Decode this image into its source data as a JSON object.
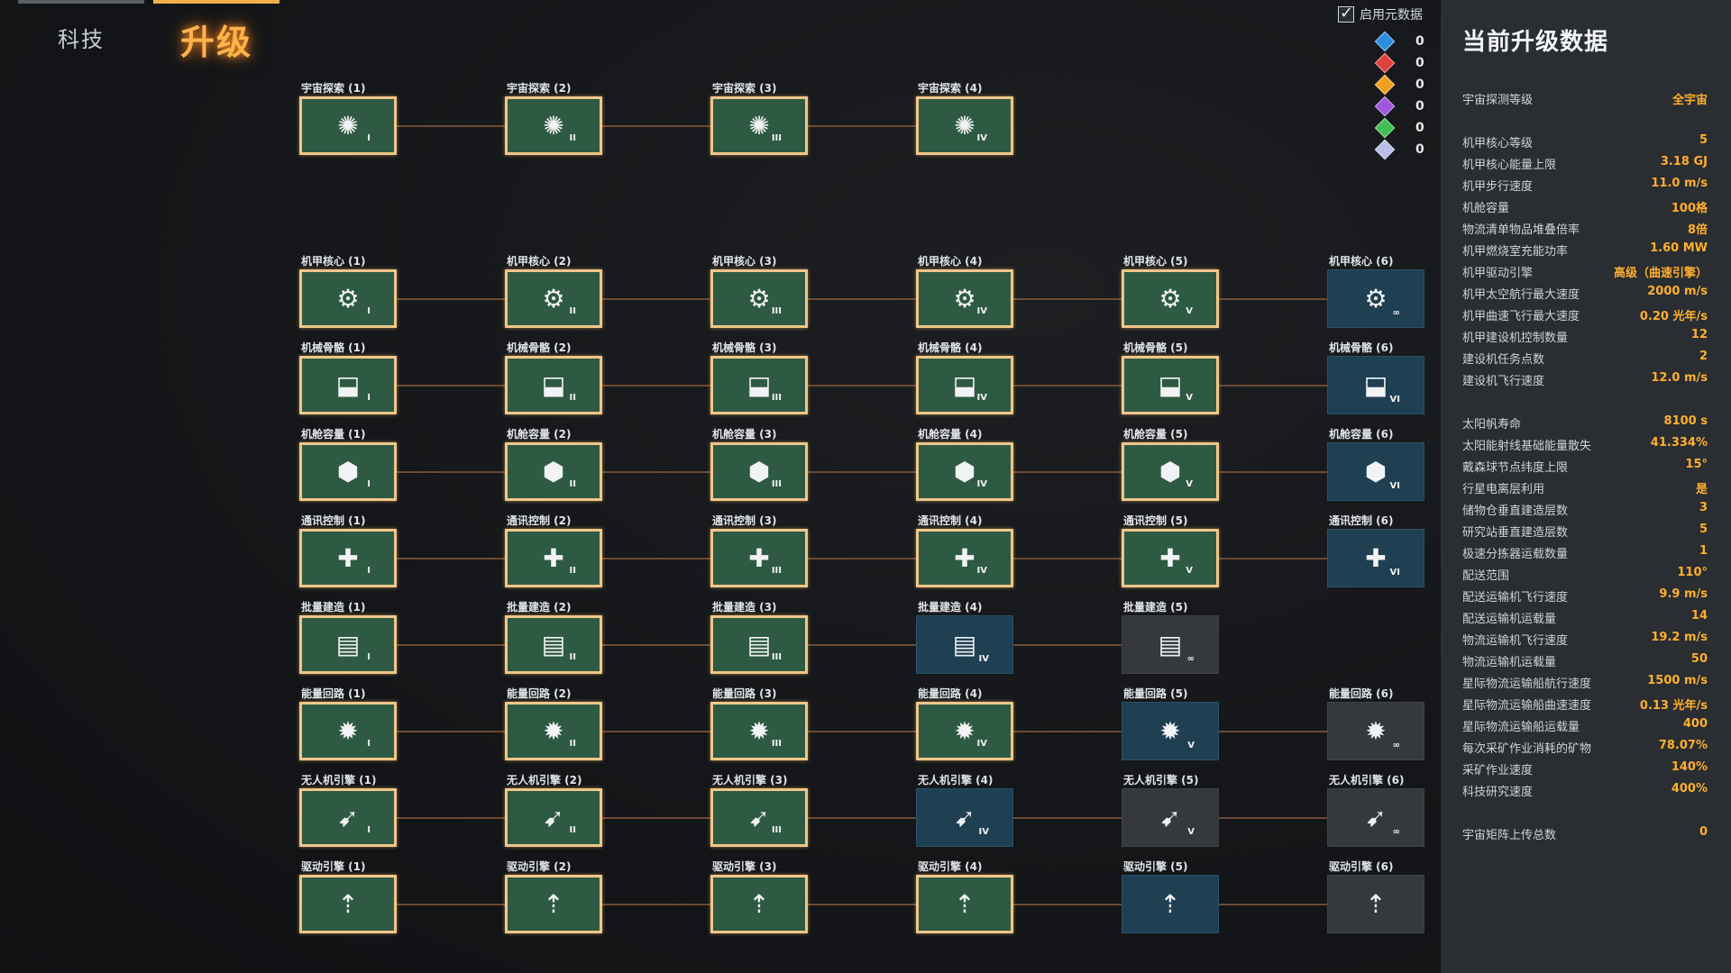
{
  "tabs": {
    "tech": "科技",
    "upgrade": "升级"
  },
  "metadata_toggle": {
    "label": "启用元数据",
    "checked": true
  },
  "counters": [
    {
      "color": "#2d8de0",
      "value": "0"
    },
    {
      "color": "#e0413a",
      "value": "0"
    },
    {
      "color": "#f0a020",
      "value": "0"
    },
    {
      "color": "#a056e0",
      "value": "0"
    },
    {
      "color": "#3fbf55",
      "value": "0"
    },
    {
      "color": "#b9bde8",
      "value": "0"
    }
  ],
  "status_colors": {
    "done": "#2e5a43",
    "available": "#1f3f52",
    "locked": "#36393c",
    "accent": "#ffb02e"
  },
  "tree_rows": [
    {
      "icon": "galaxy-icon",
      "nodes": [
        {
          "label": "宇宙探索 (1)",
          "roman": "I",
          "state": "done"
        },
        {
          "label": "宇宙探索 (2)",
          "roman": "II",
          "state": "done"
        },
        {
          "label": "宇宙探索 (3)",
          "roman": "III",
          "state": "done"
        },
        {
          "label": "宇宙探索 (4)",
          "roman": "IV",
          "state": "done"
        }
      ]
    },
    {
      "icon": "gear-core-icon",
      "nodes": [
        {
          "label": "机甲核心 (1)",
          "roman": "I",
          "state": "done"
        },
        {
          "label": "机甲核心 (2)",
          "roman": "II",
          "state": "done"
        },
        {
          "label": "机甲核心 (3)",
          "roman": "III",
          "state": "done"
        },
        {
          "label": "机甲核心 (4)",
          "roman": "IV",
          "state": "done"
        },
        {
          "label": "机甲核心 (5)",
          "roman": "V",
          "state": "done"
        },
        {
          "label": "机甲核心 (6)",
          "roman": "∞",
          "state": "available"
        }
      ]
    },
    {
      "icon": "skeleton-leg-icon",
      "nodes": [
        {
          "label": "机械骨骼 (1)",
          "roman": "I",
          "state": "done"
        },
        {
          "label": "机械骨骼 (2)",
          "roman": "II",
          "state": "done"
        },
        {
          "label": "机械骨骼 (3)",
          "roman": "III",
          "state": "done"
        },
        {
          "label": "机械骨骼 (4)",
          "roman": "IV",
          "state": "done"
        },
        {
          "label": "机械骨骼 (5)",
          "roman": "V",
          "state": "done"
        },
        {
          "label": "机械骨骼 (6)",
          "roman": "VI",
          "state": "available"
        }
      ]
    },
    {
      "icon": "cargo-box-icon",
      "nodes": [
        {
          "label": "机舱容量 (1)",
          "roman": "I",
          "state": "done"
        },
        {
          "label": "机舱容量 (2)",
          "roman": "II",
          "state": "done"
        },
        {
          "label": "机舱容量 (3)",
          "roman": "III",
          "state": "done"
        },
        {
          "label": "机舱容量 (4)",
          "roman": "IV",
          "state": "done"
        },
        {
          "label": "机舱容量 (5)",
          "roman": "V",
          "state": "done"
        },
        {
          "label": "机舱容量 (6)",
          "roman": "VI",
          "state": "available"
        }
      ]
    },
    {
      "icon": "drone-plus-icon",
      "nodes": [
        {
          "label": "通讯控制 (1)",
          "roman": "I",
          "state": "done"
        },
        {
          "label": "通讯控制 (2)",
          "roman": "II",
          "state": "done"
        },
        {
          "label": "通讯控制 (3)",
          "roman": "III",
          "state": "done"
        },
        {
          "label": "通讯控制 (4)",
          "roman": "IV",
          "state": "done"
        },
        {
          "label": "通讯控制 (5)",
          "roman": "V",
          "state": "done"
        },
        {
          "label": "通讯控制 (6)",
          "roman": "VI",
          "state": "available"
        }
      ]
    },
    {
      "icon": "blueprint-book-icon",
      "nodes": [
        {
          "label": "批量建造 (1)",
          "roman": "I",
          "state": "done"
        },
        {
          "label": "批量建造 (2)",
          "roman": "II",
          "state": "done"
        },
        {
          "label": "批量建造 (3)",
          "roman": "III",
          "state": "done"
        },
        {
          "label": "批量建造 (4)",
          "roman": "IV",
          "state": "available"
        },
        {
          "label": "批量建造 (5)",
          "roman": "∞",
          "state": "locked"
        }
      ]
    },
    {
      "icon": "energy-circuit-icon",
      "nodes": [
        {
          "label": "能量回路 (1)",
          "roman": "I",
          "state": "done"
        },
        {
          "label": "能量回路 (2)",
          "roman": "II",
          "state": "done"
        },
        {
          "label": "能量回路 (3)",
          "roman": "III",
          "state": "done"
        },
        {
          "label": "能量回路 (4)",
          "roman": "IV",
          "state": "done"
        },
        {
          "label": "能量回路 (5)",
          "roman": "V",
          "state": "available"
        },
        {
          "label": "能量回路 (6)",
          "roman": "∞",
          "state": "locked"
        }
      ]
    },
    {
      "icon": "drone-engine-icon",
      "nodes": [
        {
          "label": "无人机引擎 (1)",
          "roman": "I",
          "state": "done"
        },
        {
          "label": "无人机引擎 (2)",
          "roman": "II",
          "state": "done"
        },
        {
          "label": "无人机引擎 (3)",
          "roman": "III",
          "state": "done"
        },
        {
          "label": "无人机引擎 (4)",
          "roman": "IV",
          "state": "available"
        },
        {
          "label": "无人机引擎 (5)",
          "roman": "V",
          "state": "locked"
        },
        {
          "label": "无人机引擎 (6)",
          "roman": "∞",
          "state": "locked"
        }
      ]
    },
    {
      "icon": "drive-engine-icon",
      "nodes": [
        {
          "label": "驱动引擎 (1)",
          "roman": "",
          "state": "done"
        },
        {
          "label": "驱动引擎 (2)",
          "roman": "",
          "state": "done"
        },
        {
          "label": "驱动引擎 (3)",
          "roman": "",
          "state": "done"
        },
        {
          "label": "驱动引擎 (4)",
          "roman": "",
          "state": "done"
        },
        {
          "label": "驱动引擎 (5)",
          "roman": "",
          "state": "available"
        },
        {
          "label": "驱动引擎 (6)",
          "roman": "",
          "state": "locked"
        }
      ]
    }
  ],
  "panel": {
    "title": "当前升级数据",
    "groups": [
      [
        {
          "k": "宇宙探测等级",
          "v": "全宇宙"
        }
      ],
      [
        {
          "k": "机甲核心等级",
          "v": "5"
        },
        {
          "k": "机甲核心能量上限",
          "v": "3.18 GJ"
        },
        {
          "k": "机甲步行速度",
          "v": "11.0 m/s"
        },
        {
          "k": "机舱容量",
          "v": "100格"
        },
        {
          "k": "物流清单物品堆叠倍率",
          "v": "8倍"
        },
        {
          "k": "机甲燃烧室充能功率",
          "v": "1.60 MW"
        },
        {
          "k": "机甲驱动引擎",
          "v": "高级（曲速引擎）"
        },
        {
          "k": "机甲太空航行最大速度",
          "v": "2000 m/s"
        },
        {
          "k": "机甲曲速飞行最大速度",
          "v": "0.20 光年/s"
        },
        {
          "k": "机甲建设机控制数量",
          "v": "12"
        },
        {
          "k": "建设机任务点数",
          "v": "2"
        },
        {
          "k": "建设机飞行速度",
          "v": "12.0 m/s"
        }
      ],
      [
        {
          "k": "太阳帆寿命",
          "v": "8100 s"
        },
        {
          "k": "太阳能射线基础能量散失",
          "v": "41.334%"
        },
        {
          "k": "戴森球节点纬度上限",
          "v": "15°"
        },
        {
          "k": "行星电离层利用",
          "v": "是"
        },
        {
          "k": "储物仓垂直建造层数",
          "v": "3"
        },
        {
          "k": "研究站垂直建造层数",
          "v": "5"
        },
        {
          "k": "极速分拣器运载数量",
          "v": "1"
        },
        {
          "k": "配送范围",
          "v": "110°"
        },
        {
          "k": "配送运输机飞行速度",
          "v": "9.9 m/s"
        },
        {
          "k": "配送运输机运载量",
          "v": "14"
        },
        {
          "k": "物流运输机飞行速度",
          "v": "19.2 m/s"
        },
        {
          "k": "物流运输机运载量",
          "v": "50"
        },
        {
          "k": "星际物流运输船航行速度",
          "v": "1500 m/s"
        },
        {
          "k": "星际物流运输船曲速速度",
          "v": "0.13 光年/s"
        },
        {
          "k": "星际物流运输船运载量",
          "v": "400"
        },
        {
          "k": "每次采矿作业消耗的矿物",
          "v": "78.07%"
        },
        {
          "k": "采矿作业速度",
          "v": "140%"
        },
        {
          "k": "科技研究速度",
          "v": "400%"
        }
      ],
      [
        {
          "k": "宇宙矩阵上传总数",
          "v": "0"
        }
      ]
    ]
  }
}
